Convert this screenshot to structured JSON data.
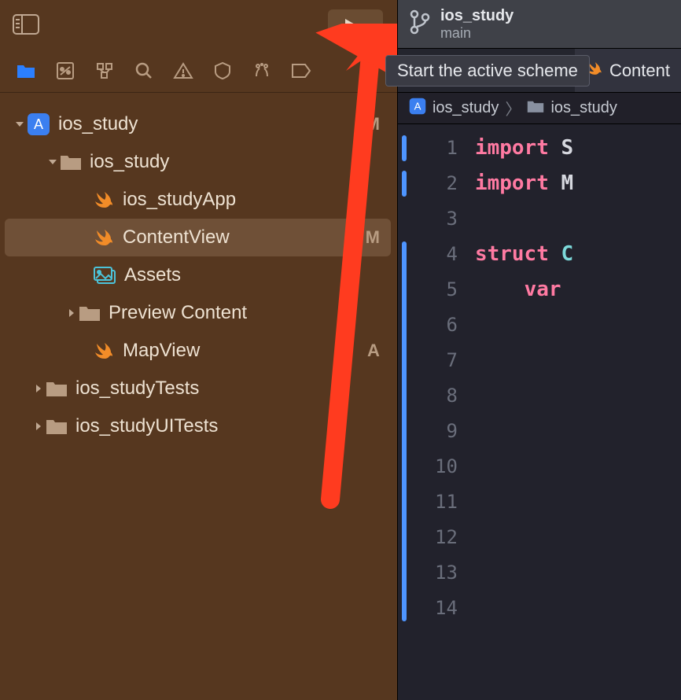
{
  "toolbar": {
    "tooltip_text": "Start the active scheme"
  },
  "scheme": {
    "project": "ios_study",
    "branch": "main"
  },
  "tabs": [
    {
      "label": "Content"
    }
  ],
  "breadcrumb": {
    "items": [
      "ios_study",
      "ios_study"
    ]
  },
  "file_tree": {
    "root": {
      "label": "ios_study",
      "status": "M",
      "children": [
        {
          "label": "ios_study",
          "type": "folder",
          "expanded": true,
          "children": [
            {
              "label": "ios_studyApp",
              "type": "swift"
            },
            {
              "label": "ContentView",
              "type": "swift",
              "status": "M",
              "selected": true
            },
            {
              "label": "Assets",
              "type": "assets"
            },
            {
              "label": "Preview Content",
              "type": "folder"
            },
            {
              "label": "MapView",
              "type": "swift",
              "status": "A"
            }
          ]
        },
        {
          "label": "ios_studyTests",
          "type": "folder"
        },
        {
          "label": "ios_studyUITests",
          "type": "folder"
        }
      ]
    }
  },
  "code": {
    "lines": [
      {
        "n": 1,
        "tokens": [
          {
            "t": "import ",
            "c": "kw-import"
          },
          {
            "t": "S",
            "c": "plain"
          }
        ]
      },
      {
        "n": 2,
        "tokens": [
          {
            "t": "import ",
            "c": "kw-import"
          },
          {
            "t": "M",
            "c": "plain"
          }
        ]
      },
      {
        "n": 3,
        "tokens": []
      },
      {
        "n": 4,
        "tokens": [
          {
            "t": "struct ",
            "c": "kw-struct"
          },
          {
            "t": "C",
            "c": "type-name"
          }
        ]
      },
      {
        "n": 5,
        "tokens": [
          {
            "t": "    ",
            "c": "plain"
          },
          {
            "t": "var",
            "c": "kw-var"
          }
        ]
      },
      {
        "n": 6,
        "tokens": []
      },
      {
        "n": 7,
        "tokens": []
      },
      {
        "n": 8,
        "tokens": []
      },
      {
        "n": 9,
        "tokens": []
      },
      {
        "n": 10,
        "tokens": []
      },
      {
        "n": 11,
        "tokens": []
      },
      {
        "n": 12,
        "tokens": []
      },
      {
        "n": 13,
        "tokens": []
      },
      {
        "n": 14,
        "tokens": []
      }
    ],
    "change_markers": [
      {
        "start": 1,
        "end": 1
      },
      {
        "start": 2,
        "end": 2
      },
      {
        "start": 4,
        "end": 14
      }
    ]
  }
}
